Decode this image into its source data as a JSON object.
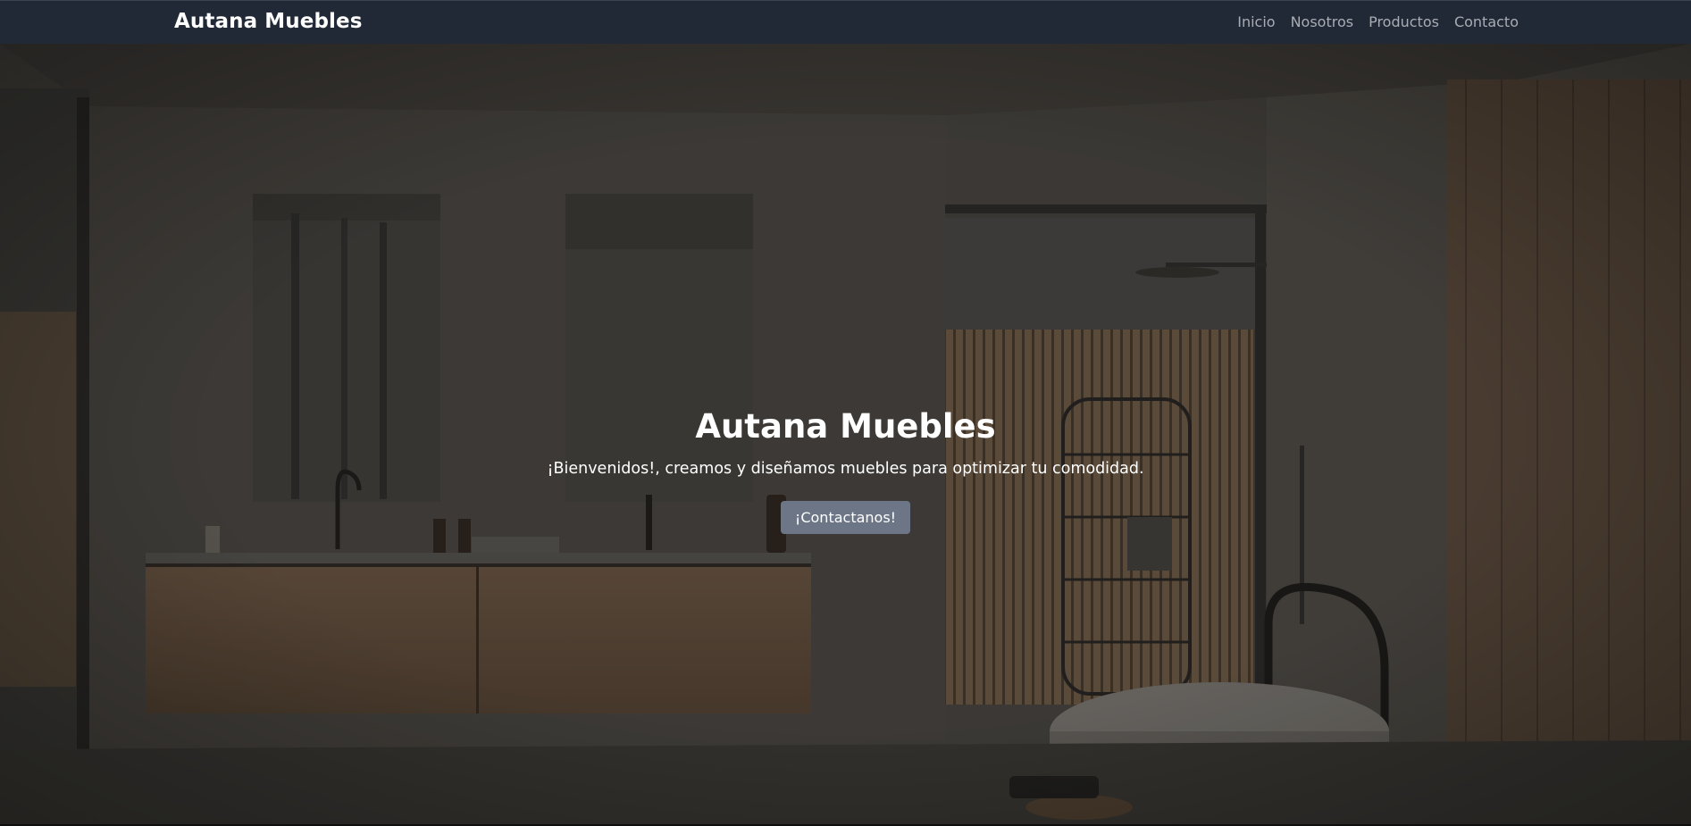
{
  "navbar": {
    "brand": "Autana Muebles",
    "links": [
      {
        "label": "Inicio"
      },
      {
        "label": "Nosotros"
      },
      {
        "label": "Productos"
      },
      {
        "label": "Contacto"
      }
    ]
  },
  "hero": {
    "title": "Autana Muebles",
    "subtitle": "¡Bienvenidos!, creamos y diseñamos muebles para optimizar tu comodidad.",
    "cta_label": "¡Contactanos!",
    "background": "bathroom-interior-photo"
  },
  "colors": {
    "navbar_bg": "#212937",
    "nav_link": "#a9adb3",
    "button_bg": "#6c7686"
  }
}
